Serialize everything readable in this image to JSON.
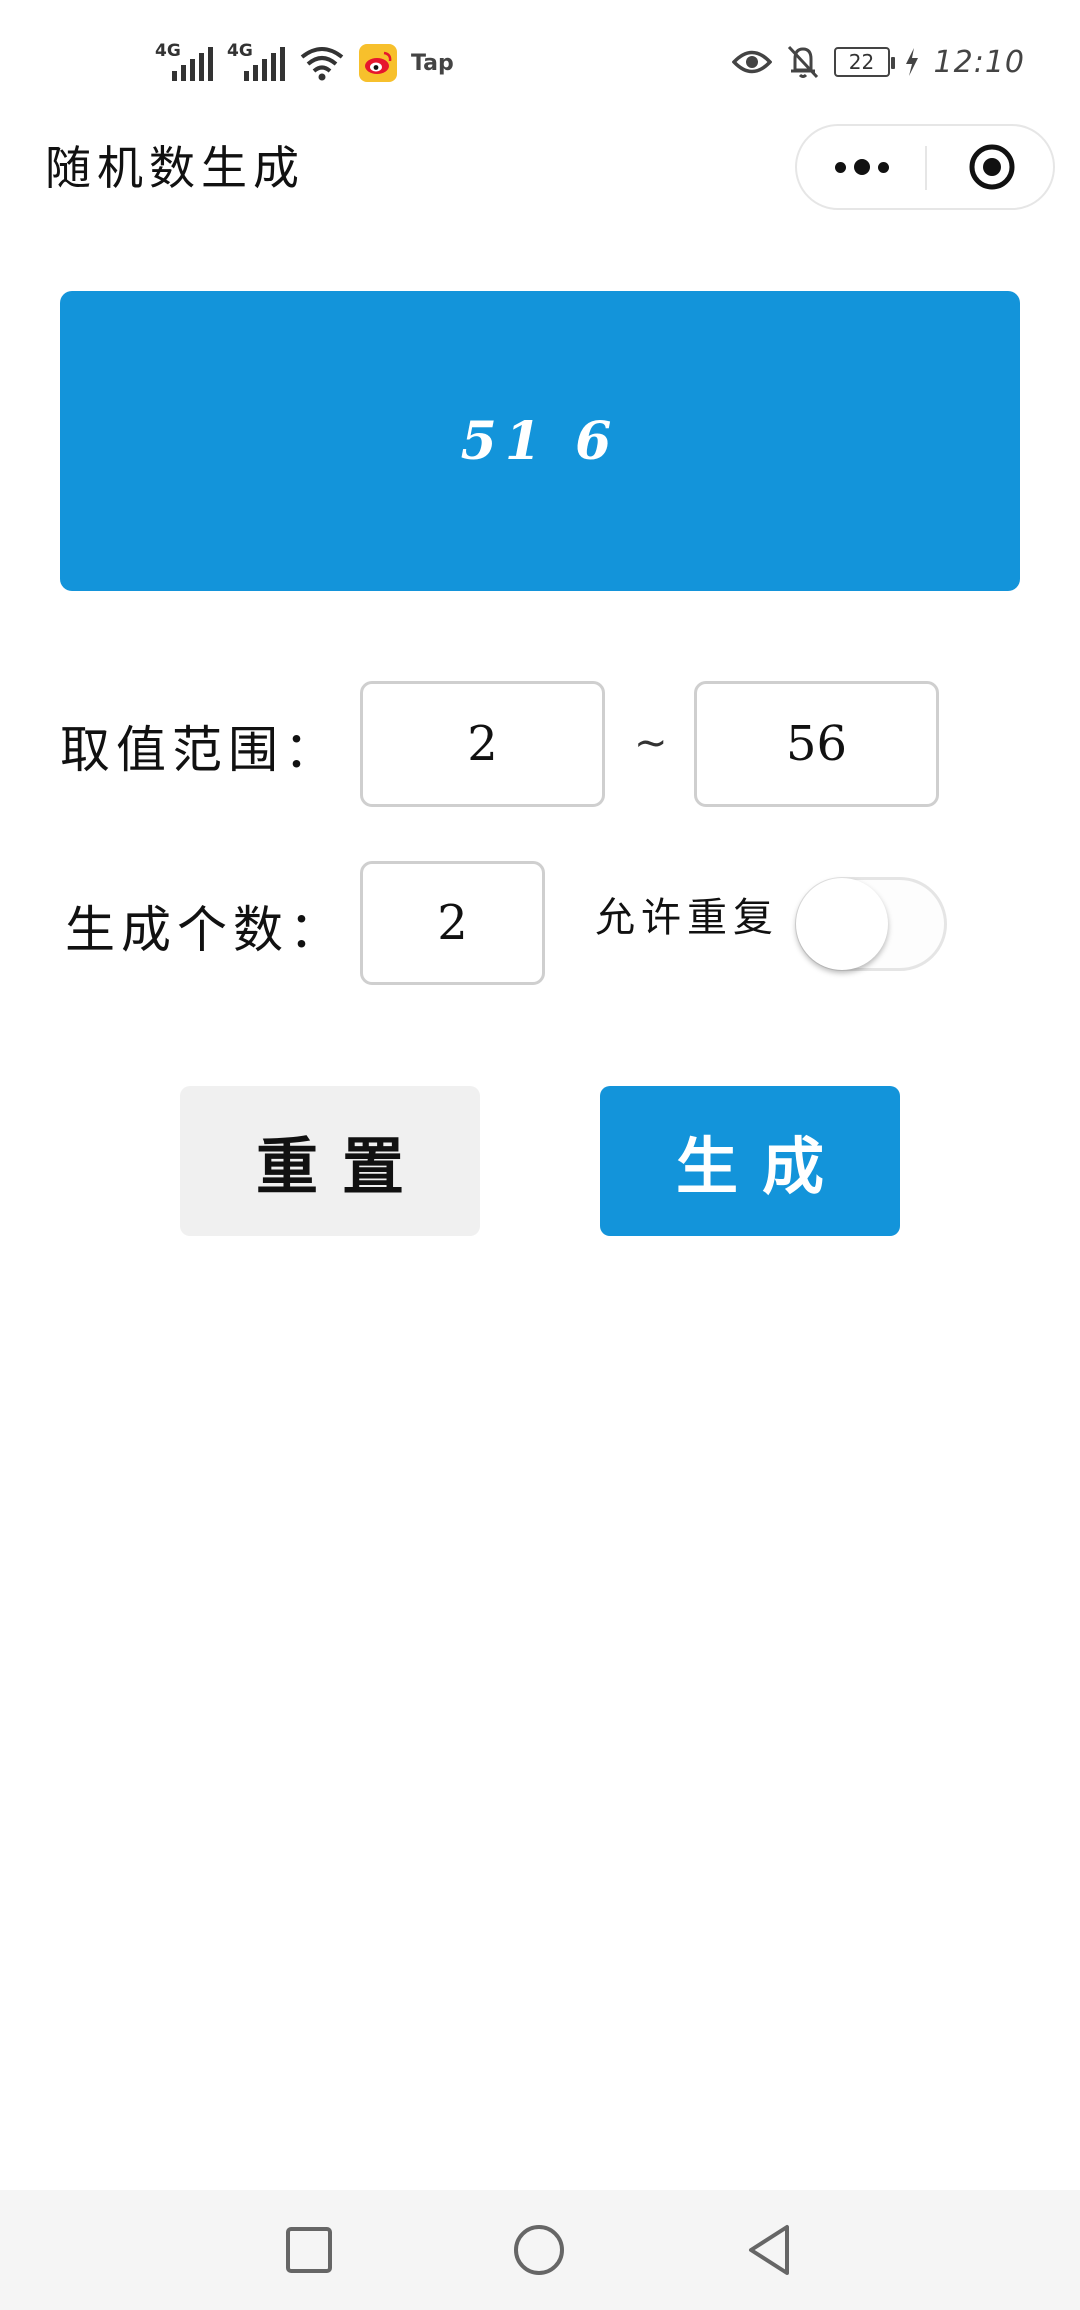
{
  "status_bar": {
    "signal_1": "4G",
    "signal_2": "4G",
    "app_label": "Tap",
    "battery": "22",
    "time": "12:10"
  },
  "title_bar": {
    "title": "随机数生成",
    "icons": [
      "more-icon",
      "close-target-icon"
    ]
  },
  "result": {
    "value": "51 6"
  },
  "range": {
    "label": "取值范围：",
    "min": "2",
    "separator": "~",
    "max": "56"
  },
  "count": {
    "label": "生成个数：",
    "value": "2"
  },
  "allow_repeat": {
    "label": "允许重复",
    "enabled": false
  },
  "buttons": {
    "reset": "重置",
    "generate": "生成"
  },
  "nav": {
    "icons": [
      "recent-apps-icon",
      "home-icon",
      "back-icon"
    ]
  },
  "colors": {
    "accent": "#1394da",
    "reset_bg": "#f0f0f0"
  }
}
